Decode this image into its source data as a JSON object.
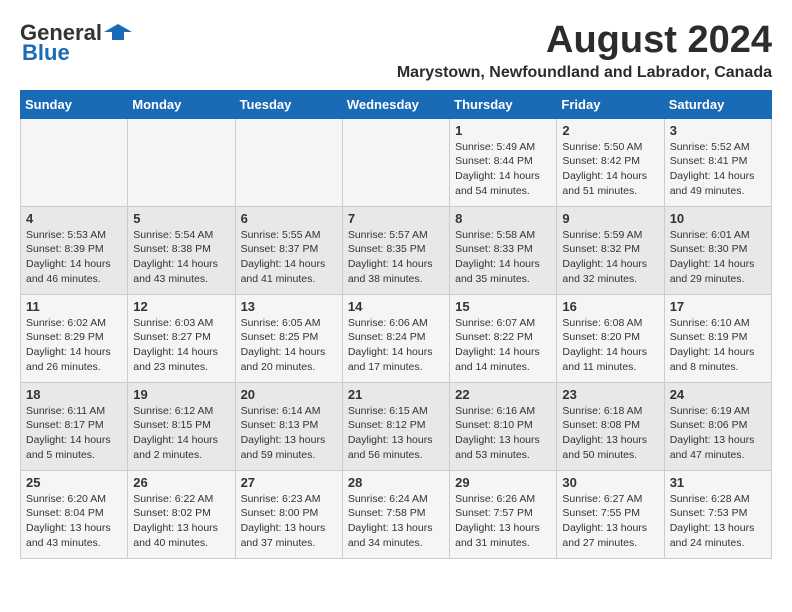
{
  "header": {
    "logo_general": "General",
    "logo_blue": "Blue",
    "month_year": "August 2024",
    "location": "Marystown, Newfoundland and Labrador, Canada"
  },
  "weekdays": [
    "Sunday",
    "Monday",
    "Tuesday",
    "Wednesday",
    "Thursday",
    "Friday",
    "Saturday"
  ],
  "weeks": [
    [
      {
        "day": "",
        "info": ""
      },
      {
        "day": "",
        "info": ""
      },
      {
        "day": "",
        "info": ""
      },
      {
        "day": "",
        "info": ""
      },
      {
        "day": "1",
        "info": "Sunrise: 5:49 AM\nSunset: 8:44 PM\nDaylight: 14 hours\nand 54 minutes."
      },
      {
        "day": "2",
        "info": "Sunrise: 5:50 AM\nSunset: 8:42 PM\nDaylight: 14 hours\nand 51 minutes."
      },
      {
        "day": "3",
        "info": "Sunrise: 5:52 AM\nSunset: 8:41 PM\nDaylight: 14 hours\nand 49 minutes."
      }
    ],
    [
      {
        "day": "4",
        "info": "Sunrise: 5:53 AM\nSunset: 8:39 PM\nDaylight: 14 hours\nand 46 minutes."
      },
      {
        "day": "5",
        "info": "Sunrise: 5:54 AM\nSunset: 8:38 PM\nDaylight: 14 hours\nand 43 minutes."
      },
      {
        "day": "6",
        "info": "Sunrise: 5:55 AM\nSunset: 8:37 PM\nDaylight: 14 hours\nand 41 minutes."
      },
      {
        "day": "7",
        "info": "Sunrise: 5:57 AM\nSunset: 8:35 PM\nDaylight: 14 hours\nand 38 minutes."
      },
      {
        "day": "8",
        "info": "Sunrise: 5:58 AM\nSunset: 8:33 PM\nDaylight: 14 hours\nand 35 minutes."
      },
      {
        "day": "9",
        "info": "Sunrise: 5:59 AM\nSunset: 8:32 PM\nDaylight: 14 hours\nand 32 minutes."
      },
      {
        "day": "10",
        "info": "Sunrise: 6:01 AM\nSunset: 8:30 PM\nDaylight: 14 hours\nand 29 minutes."
      }
    ],
    [
      {
        "day": "11",
        "info": "Sunrise: 6:02 AM\nSunset: 8:29 PM\nDaylight: 14 hours\nand 26 minutes."
      },
      {
        "day": "12",
        "info": "Sunrise: 6:03 AM\nSunset: 8:27 PM\nDaylight: 14 hours\nand 23 minutes."
      },
      {
        "day": "13",
        "info": "Sunrise: 6:05 AM\nSunset: 8:25 PM\nDaylight: 14 hours\nand 20 minutes."
      },
      {
        "day": "14",
        "info": "Sunrise: 6:06 AM\nSunset: 8:24 PM\nDaylight: 14 hours\nand 17 minutes."
      },
      {
        "day": "15",
        "info": "Sunrise: 6:07 AM\nSunset: 8:22 PM\nDaylight: 14 hours\nand 14 minutes."
      },
      {
        "day": "16",
        "info": "Sunrise: 6:08 AM\nSunset: 8:20 PM\nDaylight: 14 hours\nand 11 minutes."
      },
      {
        "day": "17",
        "info": "Sunrise: 6:10 AM\nSunset: 8:19 PM\nDaylight: 14 hours\nand 8 minutes."
      }
    ],
    [
      {
        "day": "18",
        "info": "Sunrise: 6:11 AM\nSunset: 8:17 PM\nDaylight: 14 hours\nand 5 minutes."
      },
      {
        "day": "19",
        "info": "Sunrise: 6:12 AM\nSunset: 8:15 PM\nDaylight: 14 hours\nand 2 minutes."
      },
      {
        "day": "20",
        "info": "Sunrise: 6:14 AM\nSunset: 8:13 PM\nDaylight: 13 hours\nand 59 minutes."
      },
      {
        "day": "21",
        "info": "Sunrise: 6:15 AM\nSunset: 8:12 PM\nDaylight: 13 hours\nand 56 minutes."
      },
      {
        "day": "22",
        "info": "Sunrise: 6:16 AM\nSunset: 8:10 PM\nDaylight: 13 hours\nand 53 minutes."
      },
      {
        "day": "23",
        "info": "Sunrise: 6:18 AM\nSunset: 8:08 PM\nDaylight: 13 hours\nand 50 minutes."
      },
      {
        "day": "24",
        "info": "Sunrise: 6:19 AM\nSunset: 8:06 PM\nDaylight: 13 hours\nand 47 minutes."
      }
    ],
    [
      {
        "day": "25",
        "info": "Sunrise: 6:20 AM\nSunset: 8:04 PM\nDaylight: 13 hours\nand 43 minutes."
      },
      {
        "day": "26",
        "info": "Sunrise: 6:22 AM\nSunset: 8:02 PM\nDaylight: 13 hours\nand 40 minutes."
      },
      {
        "day": "27",
        "info": "Sunrise: 6:23 AM\nSunset: 8:00 PM\nDaylight: 13 hours\nand 37 minutes."
      },
      {
        "day": "28",
        "info": "Sunrise: 6:24 AM\nSunset: 7:58 PM\nDaylight: 13 hours\nand 34 minutes."
      },
      {
        "day": "29",
        "info": "Sunrise: 6:26 AM\nSunset: 7:57 PM\nDaylight: 13 hours\nand 31 minutes."
      },
      {
        "day": "30",
        "info": "Sunrise: 6:27 AM\nSunset: 7:55 PM\nDaylight: 13 hours\nand 27 minutes."
      },
      {
        "day": "31",
        "info": "Sunrise: 6:28 AM\nSunset: 7:53 PM\nDaylight: 13 hours\nand 24 minutes."
      }
    ]
  ]
}
